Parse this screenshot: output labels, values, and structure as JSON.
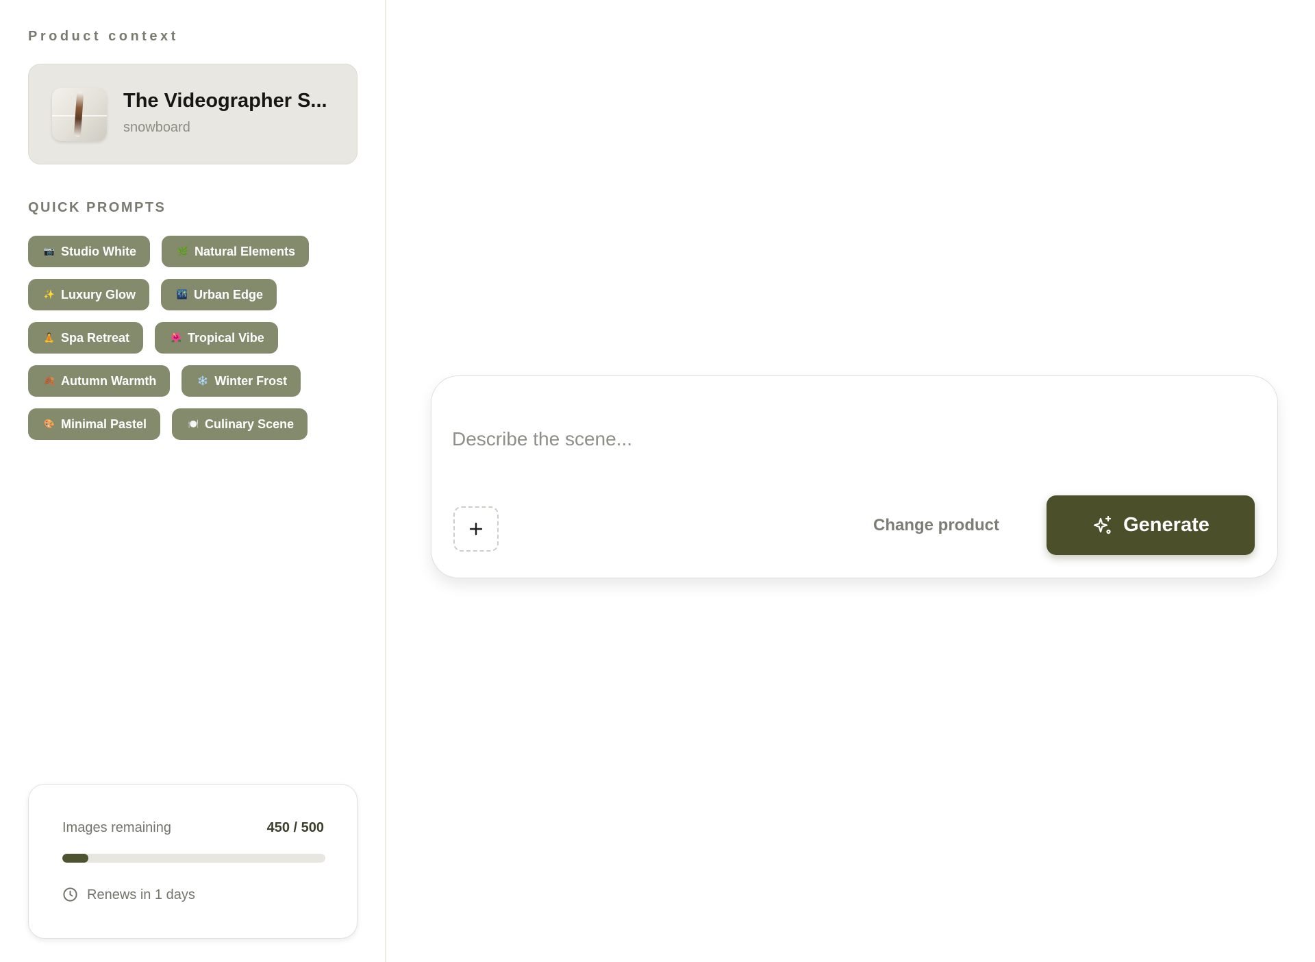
{
  "sidebar": {
    "product_context_label": "Product context",
    "product": {
      "title": "The Videographer S...",
      "subtitle": "snowboard",
      "thumbnail_icon": "snowboard-thumbnail"
    },
    "quick_prompts_label": "QUICK PROMPTS",
    "quick_prompts": [
      [
        {
          "label": "Studio White",
          "icon": "📷"
        },
        {
          "label": "Natural Elements",
          "icon": "🌿"
        }
      ],
      [
        {
          "label": "Luxury Glow",
          "icon": "✨"
        },
        {
          "label": "Urban Edge",
          "icon": "🌃"
        }
      ],
      [
        {
          "label": "Spa Retreat",
          "icon": "🧘"
        },
        {
          "label": "Tropical Vibe",
          "icon": "🌺"
        }
      ],
      [
        {
          "label": "Autumn Warmth",
          "icon": "🍂"
        },
        {
          "label": "Winter Frost",
          "icon": "❄️"
        }
      ],
      [
        {
          "label": "Minimal Pastel",
          "icon": "🎨"
        },
        {
          "label": "Culinary Scene",
          "icon": "🍽️"
        }
      ]
    ],
    "usage": {
      "label": "Images remaining",
      "count": "450 / 500",
      "progress_fraction": 0.1,
      "renew_text": "Renews in 1 days"
    }
  },
  "composer": {
    "placeholder": "Describe the scene...",
    "value": "",
    "add_icon": "plus-icon",
    "change_product_label": "Change product",
    "generate_label": "Generate",
    "generate_icon": "sparkles-icon"
  },
  "colors": {
    "chip_bg": "#848a6c",
    "accent": "#4b502a",
    "card_bg": "#e9e7e1"
  }
}
